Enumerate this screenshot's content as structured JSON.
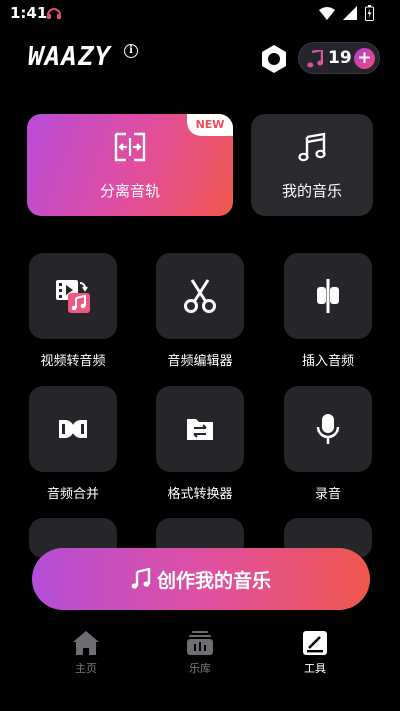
{
  "status": {
    "time": "1:41"
  },
  "header": {
    "logo": "WAAZY",
    "info_icon": "info-icon",
    "credits": "19"
  },
  "features": {
    "separate": {
      "label": "分离音轨",
      "badge": "NEW"
    },
    "my_music": {
      "label": "我的音乐"
    }
  },
  "tools": [
    {
      "label": "视频转音频",
      "icon": "video-to-audio-icon"
    },
    {
      "label": "音频编辑器",
      "icon": "scissors-icon"
    },
    {
      "label": "插入音频",
      "icon": "insert-audio-icon"
    },
    {
      "label": "音频合并",
      "icon": "merge-icon"
    },
    {
      "label": "格式转换器",
      "icon": "format-convert-icon"
    },
    {
      "label": "录音",
      "icon": "microphone-icon"
    }
  ],
  "cta": {
    "label": "创作我的音乐"
  },
  "nav": [
    {
      "label": "主页",
      "icon": "home-icon"
    },
    {
      "label": "乐库",
      "icon": "library-icon"
    },
    {
      "label": "工具",
      "icon": "tools-icon"
    }
  ],
  "colors": {
    "accent_start": "#b44ed7",
    "accent_mid": "#e2509c",
    "accent_end": "#f0584c",
    "card": "#262529"
  }
}
